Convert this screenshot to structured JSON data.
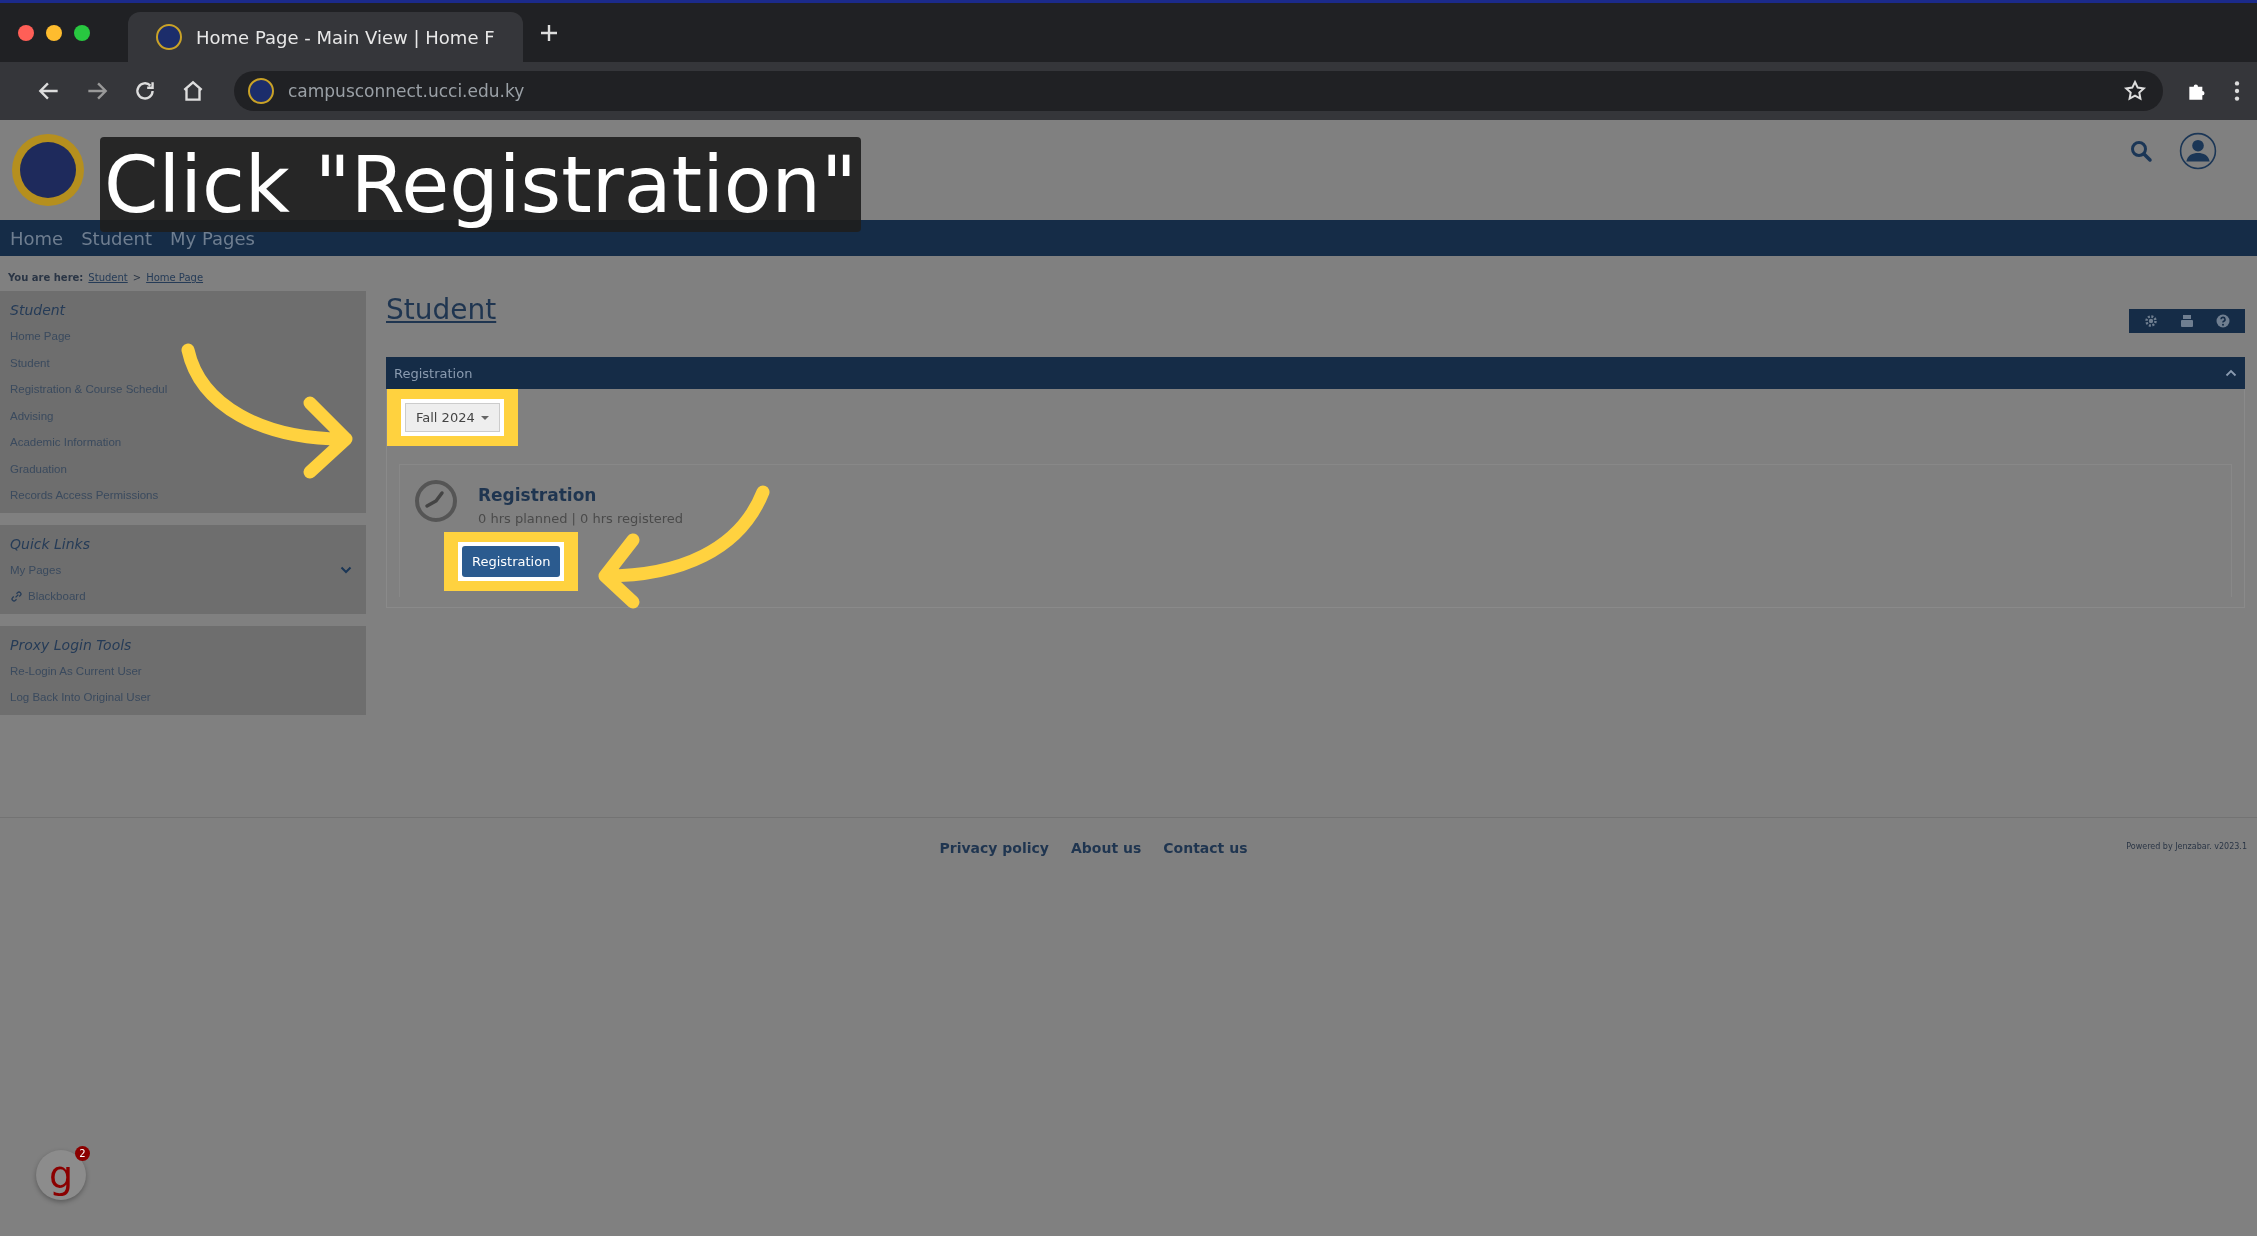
{
  "caption": "Click \"Registration\"",
  "browser": {
    "tab_title": "Home Page - Main View | Home F",
    "url": "campusconnect.ucci.edu.ky"
  },
  "nav": [
    "Home",
    "Student",
    "My Pages"
  ],
  "breadcrumb": {
    "label": "You are here:",
    "path": [
      "Student",
      "Home Page"
    ],
    "separator": ">"
  },
  "sidebar": [
    {
      "title": "Student",
      "items": [
        {
          "label": "Home Page",
          "kind": "plain"
        },
        {
          "label": "Student",
          "kind": "plain"
        },
        {
          "label": "Registration & Course Schedul",
          "kind": "plain"
        },
        {
          "label": "Advising",
          "kind": "plain"
        },
        {
          "label": "Academic Information",
          "kind": "plain"
        },
        {
          "label": "Graduation",
          "kind": "plain"
        },
        {
          "label": "Records Access Permissions",
          "kind": "plain"
        }
      ]
    },
    {
      "title": "Quick Links",
      "items": [
        {
          "label": "My Pages",
          "kind": "expand"
        },
        {
          "label": "Blackboard",
          "kind": "link"
        }
      ]
    },
    {
      "title": "Proxy Login Tools",
      "items": [
        {
          "label": "Re-Login As Current User",
          "kind": "plain"
        },
        {
          "label": "Log Back Into Original User",
          "kind": "plain"
        }
      ]
    }
  ],
  "page_title": "Student",
  "panel": {
    "title": "Registration",
    "term": {
      "value": "Fall 2024",
      "highlighted": true
    },
    "card": {
      "title": "Registration",
      "summary": "0 hrs planned | 0 hrs registered",
      "button": {
        "label": "Registration",
        "highlighted": true
      }
    }
  },
  "footer": {
    "links": [
      "Privacy policy",
      "About us",
      "Contact us"
    ],
    "powered_by": "Powered by Jenzabar. v2023.1"
  },
  "chat_badge": {
    "letter": "g",
    "count": "2"
  }
}
